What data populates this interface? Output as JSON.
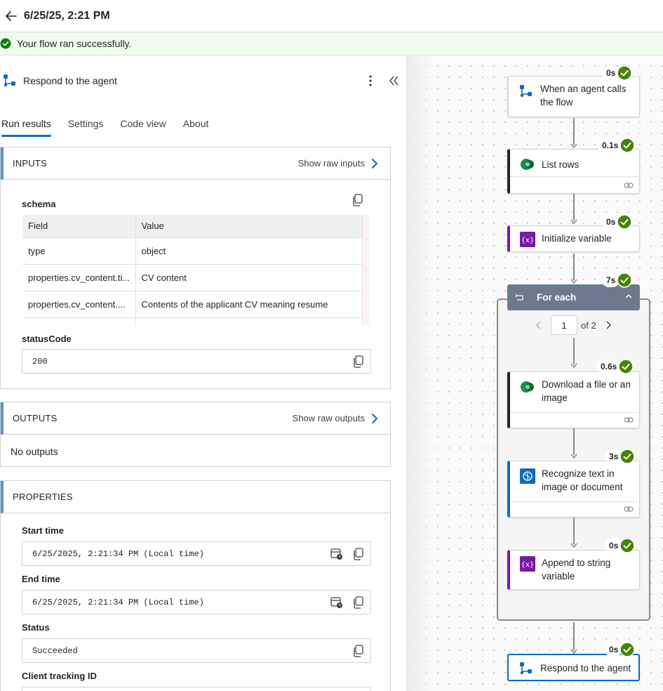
{
  "header": {
    "title": "6/25/25, 2:21 PM"
  },
  "banner": {
    "message": "Your flow ran successfully."
  },
  "panel": {
    "action_name": "Respond to the agent",
    "tabs": [
      "Run results",
      "Settings",
      "Code view",
      "About"
    ],
    "inputs": {
      "title": "INPUTS",
      "raw_link": "Show raw inputs",
      "schema_label": "schema",
      "columns": [
        "Field",
        "Value"
      ],
      "rows": [
        [
          "type",
          "object"
        ],
        [
          "properties.cv_content.ti...",
          "CV content"
        ],
        [
          "properties.cv_content....",
          "Contents of the applicant CV meaning resume"
        ],
        [
          "",
          ""
        ]
      ],
      "status_label": "statusCode",
      "status_value": "200"
    },
    "outputs": {
      "title": "OUTPUTS",
      "raw_link": "Show raw outputs",
      "empty_text": "No outputs"
    },
    "properties": {
      "title": "PROPERTIES",
      "start_label": "Start time",
      "start_value": "6/25/2025, 2:21:34 PM (Local time)",
      "end_label": "End time",
      "end_value": "6/25/2025, 2:21:34 PM (Local time)",
      "status_label": "Status",
      "status_value": "Succeeded",
      "tracking_label": "Client tracking ID"
    }
  },
  "flow": {
    "nodes": [
      {
        "label": "When an agent calls the flow",
        "duration": "0s"
      },
      {
        "label": "List rows",
        "duration": "0.1s"
      },
      {
        "label": "Initialize variable",
        "duration": "0s"
      },
      {
        "label": "For each",
        "duration": "7s"
      },
      {
        "label": "Download a file or an image",
        "duration": "0.6s"
      },
      {
        "label": "Recognize text in image or document",
        "duration": "3s"
      },
      {
        "label": "Append to string variable",
        "duration": "0s"
      },
      {
        "label": "Respond to the agent",
        "duration": "0s"
      }
    ],
    "pager": {
      "current": "1",
      "of": "of 2"
    }
  },
  "colors": {
    "accent": "#0f6cbd",
    "success": "#107c10",
    "loop_header": "#6b7a8c",
    "variable": "#7719aa"
  }
}
